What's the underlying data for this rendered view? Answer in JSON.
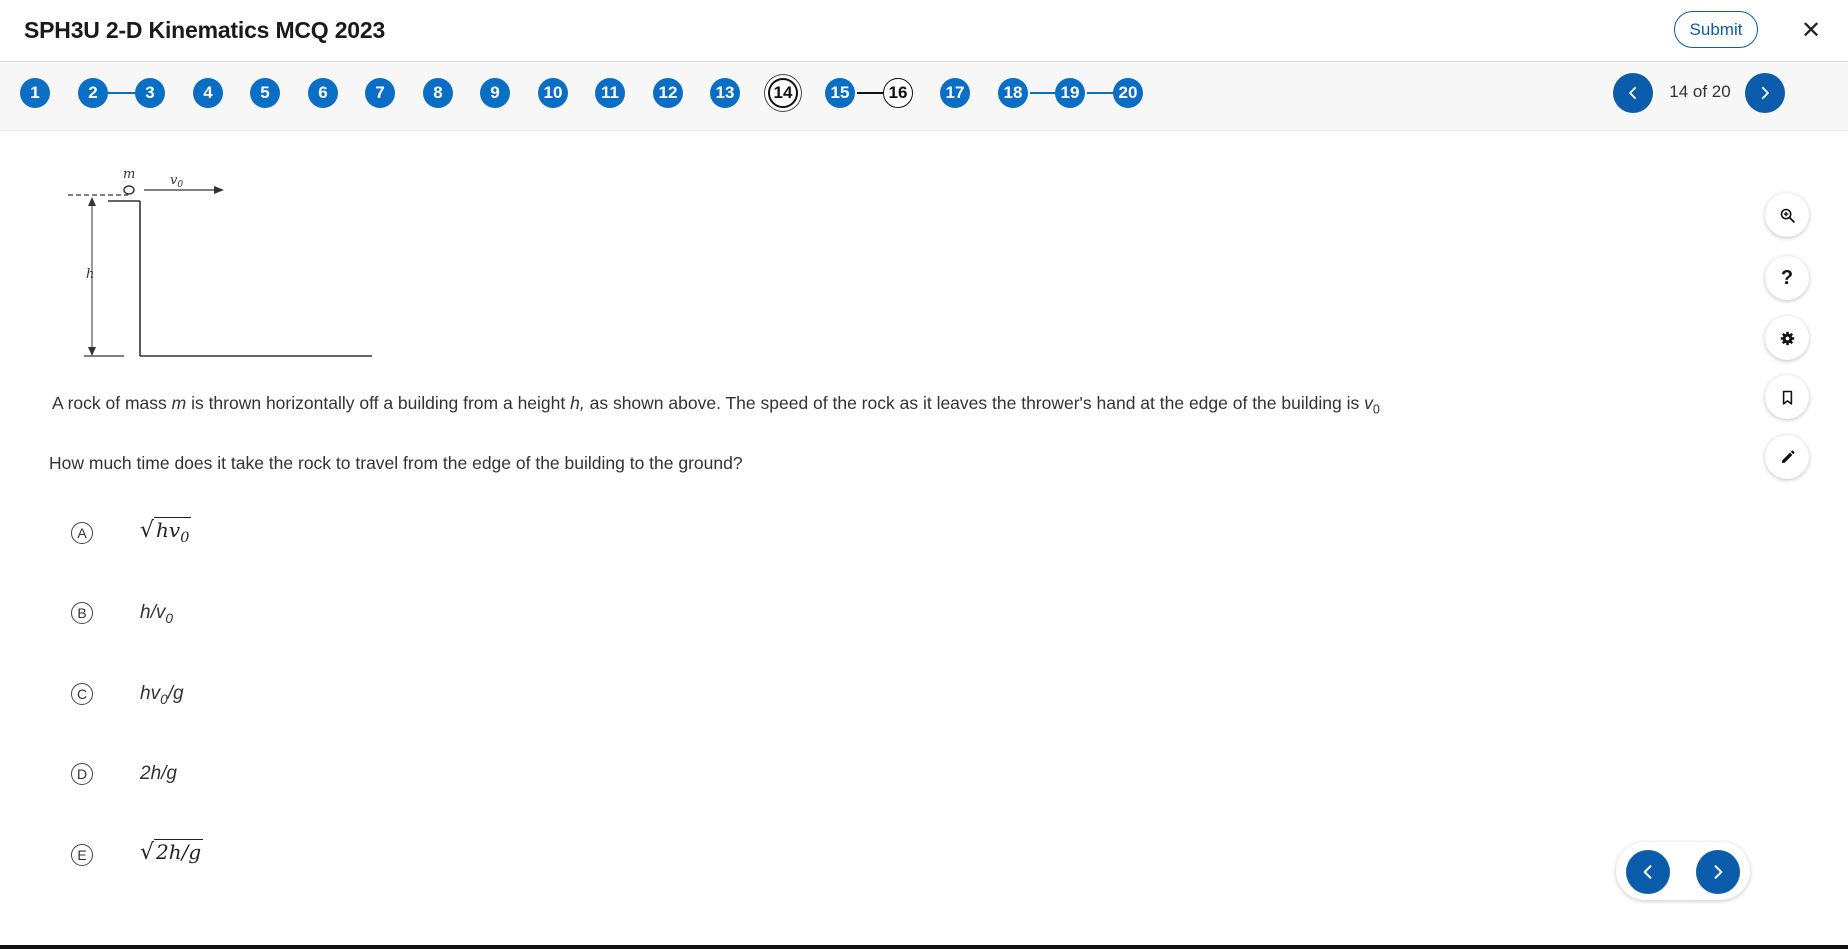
{
  "header": {
    "title": "SPH3U 2-D Kinematics MCQ 2023",
    "submit_label": "Submit",
    "close_glyph": "✕"
  },
  "nav": {
    "counter": "14 of 20",
    "current": "14",
    "questions": [
      "1",
      "2",
      "3",
      "4",
      "5",
      "6",
      "7",
      "8",
      "9",
      "10",
      "11",
      "12",
      "13",
      "14",
      "15",
      "16",
      "17",
      "18",
      "19",
      "20"
    ]
  },
  "diagram": {
    "mass_label": "m",
    "velocity_label": "v",
    "velocity_sub": "0",
    "height_label": "h"
  },
  "question": {
    "stem_a": "A rock of mass ",
    "stem_m": "m",
    "stem_b": " is thrown horizontally off a building from a height ",
    "stem_h": "h,",
    "stem_c": " as shown above. The speed of the rock as it leaves the thrower's hand at the edge of the building is ",
    "stem_v": "v",
    "stem_v_sub": "0",
    "prompt": "How much time does it take the rock to travel from the edge of the building to the ground?"
  },
  "options": [
    {
      "letter": "A",
      "pre": "hv",
      "sub": "0",
      "post": ""
    },
    {
      "letter": "B",
      "pre": "h/v",
      "sub": "0",
      "post": ""
    },
    {
      "letter": "C",
      "pre": "hv",
      "sub": "0",
      "post": "/g"
    },
    {
      "letter": "D",
      "pre": "2h/g",
      "sub": "",
      "post": ""
    },
    {
      "letter": "E",
      "pre": "2h/g",
      "sub": "",
      "post": ""
    }
  ],
  "colors": {
    "accent": "#0b6ec5",
    "accent_dark": "#0b5cab"
  },
  "icons": {
    "prev": "chevron-left-icon",
    "next": "chevron-right-icon",
    "zoom": "zoom-in-icon",
    "help": "help-icon",
    "settings": "gear-icon",
    "bookmark": "bookmark-icon",
    "annotate": "pencil-icon"
  },
  "tools": {
    "help_glyph": "?"
  }
}
